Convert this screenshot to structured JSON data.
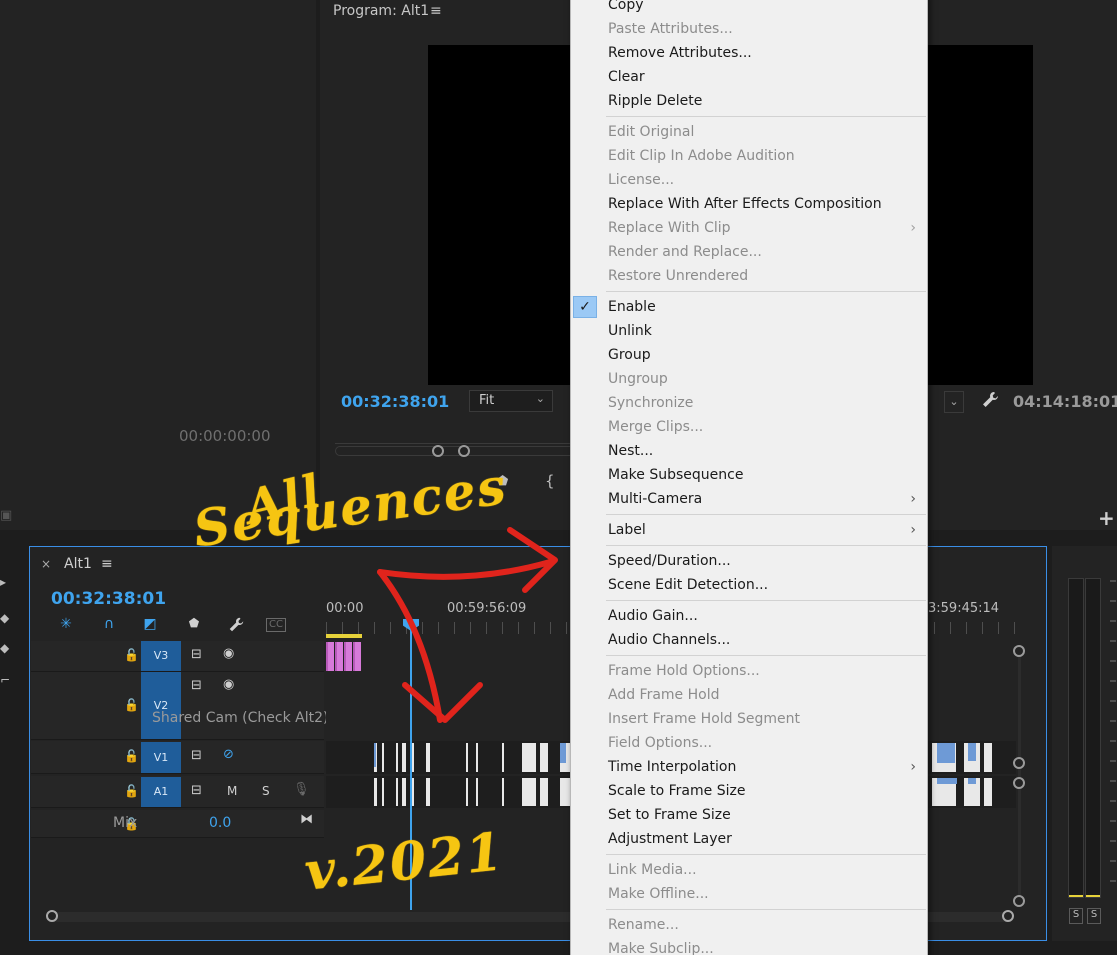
{
  "source_monitor": {
    "timecode": "00:00:00:00"
  },
  "program_monitor": {
    "title": "Program: Alt1",
    "menu_glyph": "≡",
    "timecode": "00:32:38:01",
    "fit_value": "Fit",
    "duration": "04:14:18:01"
  },
  "timeline": {
    "close_glyph": "×",
    "title": "Alt1",
    "menu_glyph": "≡",
    "timecode": "00:32:38:01",
    "ruler": [
      "00:00",
      "00:59:56:09",
      "3:59:45:14"
    ],
    "tracks": [
      {
        "id": "V3",
        "label": "V3"
      },
      {
        "id": "V2",
        "label": "V2",
        "name": "Shared Cam (Check Alt2)"
      },
      {
        "id": "V1",
        "label": "V1"
      },
      {
        "id": "A1",
        "label": "A1",
        "m": "M",
        "s": "S"
      }
    ],
    "mix": {
      "label": "Mix",
      "value": "0.0"
    }
  },
  "audio_meter": {
    "solo_left": "S",
    "solo_right": "S"
  },
  "context_menu": {
    "items": [
      {
        "label": "Copy",
        "enabled": true
      },
      {
        "label": "Paste Attributes...",
        "enabled": false
      },
      {
        "label": "Remove Attributes...",
        "enabled": true
      },
      {
        "label": "Clear",
        "enabled": true
      },
      {
        "label": "Ripple Delete",
        "enabled": true
      },
      {
        "label": "Edit Original",
        "enabled": false
      },
      {
        "label": "Edit Clip In Adobe Audition",
        "enabled": false
      },
      {
        "label": "License...",
        "enabled": false
      },
      {
        "label": "Replace With After Effects Composition",
        "enabled": true
      },
      {
        "label": "Replace With Clip",
        "enabled": false,
        "submenu": true
      },
      {
        "label": "Render and Replace...",
        "enabled": false
      },
      {
        "label": "Restore Unrendered",
        "enabled": false
      },
      {
        "label": "Enable",
        "enabled": true,
        "checked": true
      },
      {
        "label": "Unlink",
        "enabled": true
      },
      {
        "label": "Group",
        "enabled": true
      },
      {
        "label": "Ungroup",
        "enabled": false
      },
      {
        "label": "Synchronize",
        "enabled": false
      },
      {
        "label": "Merge Clips...",
        "enabled": false
      },
      {
        "label": "Nest...",
        "enabled": true
      },
      {
        "label": "Make Subsequence",
        "enabled": true
      },
      {
        "label": "Multi-Camera",
        "enabled": true,
        "submenu": true
      },
      {
        "label": "Label",
        "enabled": true,
        "submenu": true
      },
      {
        "label": "Speed/Duration...",
        "enabled": true
      },
      {
        "label": "Scene Edit Detection...",
        "enabled": true
      },
      {
        "label": "Audio Gain...",
        "enabled": true
      },
      {
        "label": "Audio Channels...",
        "enabled": true
      },
      {
        "label": "Frame Hold Options...",
        "enabled": false
      },
      {
        "label": "Add Frame Hold",
        "enabled": false
      },
      {
        "label": "Insert Frame Hold Segment",
        "enabled": false
      },
      {
        "label": "Field Options...",
        "enabled": false
      },
      {
        "label": "Time Interpolation",
        "enabled": true,
        "submenu": true
      },
      {
        "label": "Scale to Frame Size",
        "enabled": true
      },
      {
        "label": "Set to Frame Size",
        "enabled": true
      },
      {
        "label": "Adjustment Layer",
        "enabled": true
      },
      {
        "label": "Link Media...",
        "enabled": false
      },
      {
        "label": "Make Offline...",
        "enabled": false
      },
      {
        "label": "Rename...",
        "enabled": false
      },
      {
        "label": "Make Subclip...",
        "enabled": false
      }
    ],
    "check_glyph": "✓",
    "submenu_glyph": "›"
  },
  "annotations": {
    "all": "All",
    "sequences": "Sequences",
    "version": "v.2021"
  },
  "colors": {
    "accent_blue": "#3fa4ee",
    "track_blue": "#1f5d9a",
    "annotation_yellow": "#f6c512",
    "annotation_red": "#e0241c",
    "clip_pink": "#d77ad9"
  }
}
